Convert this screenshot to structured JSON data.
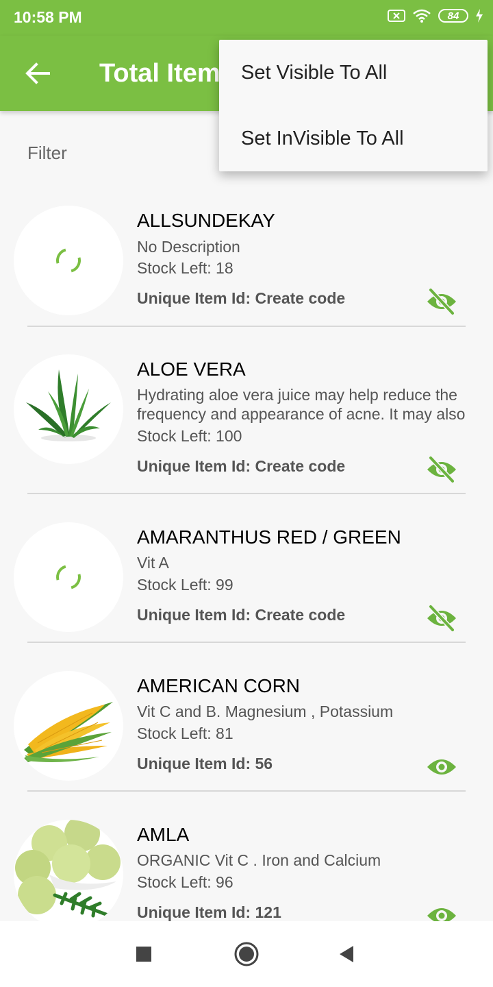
{
  "status_bar": {
    "time": "10:58 PM",
    "battery": "84"
  },
  "app_bar": {
    "title": "Total Item",
    "back_icon": "arrow-back-icon"
  },
  "filter": {
    "label": "Filter"
  },
  "menu": {
    "items": [
      {
        "label": "Set Visible To All"
      },
      {
        "label": "Set InVisible To All"
      }
    ]
  },
  "items": [
    {
      "name": "ALLSUNDEKAY",
      "description": "No Description",
      "stock": "Stock Left: 18",
      "uid": "Unique Item Id: Create code",
      "visible": false,
      "image": "loading-spinner"
    },
    {
      "name": "ALOE VERA",
      "description": "Hydrating aloe vera juice may help reduce the frequency and appearance of acne. It may also",
      "stock": "Stock Left: 100",
      "uid": "Unique Item Id: Create code",
      "visible": false,
      "image": "aloe-vera-image"
    },
    {
      "name": "AMARANTHUS  RED  / GREEN",
      "description": "Vit A",
      "stock": "Stock Left: 99",
      "uid": "Unique Item Id: Create code",
      "visible": false,
      "image": "loading-spinner"
    },
    {
      "name": "AMERICAN CORN",
      "description": "Vit C and B. Magnesium ,  Potassium",
      "stock": "Stock Left: 81",
      "uid": "Unique Item Id: 56",
      "visible": true,
      "image": "corn-image"
    },
    {
      "name": "AMLA",
      "description": "ORGANIC Vit C  .  Iron and Calcium",
      "stock": "Stock Left: 96",
      "uid": "Unique Item Id: 121",
      "visible": true,
      "image": "amla-image"
    }
  ],
  "colors": {
    "primary": "#7bbf43",
    "accent": "#6cb33f"
  },
  "nav_bar": {
    "recents_icon": "square-icon",
    "home_icon": "circle-icon",
    "back_icon": "triangle-back-icon"
  }
}
